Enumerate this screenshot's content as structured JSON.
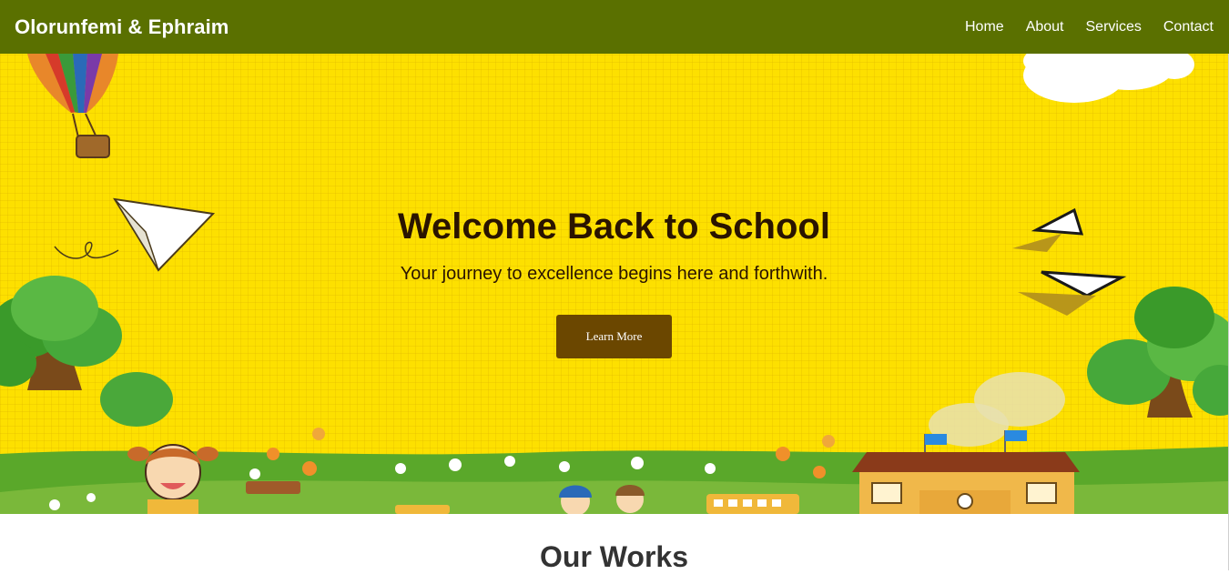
{
  "navbar": {
    "brand": "Olorunfemi & Ephraim",
    "links": [
      "Home",
      "About",
      "Services",
      "Contact"
    ]
  },
  "hero": {
    "title": "Welcome Back to School",
    "subtitle": "Your journey to excellence begins here and forthwith.",
    "button_label": "Learn More"
  },
  "works": {
    "title": "Our Works"
  },
  "colors": {
    "navbar": "#5a7000",
    "hero_background": "#fde000",
    "button": "#6b4700",
    "heading_text": "#2a1400"
  },
  "illustration_elements": [
    "hot-air-balloon",
    "paper-plane",
    "clouds",
    "trees",
    "school-building",
    "school-bus",
    "flowers",
    "children"
  ]
}
